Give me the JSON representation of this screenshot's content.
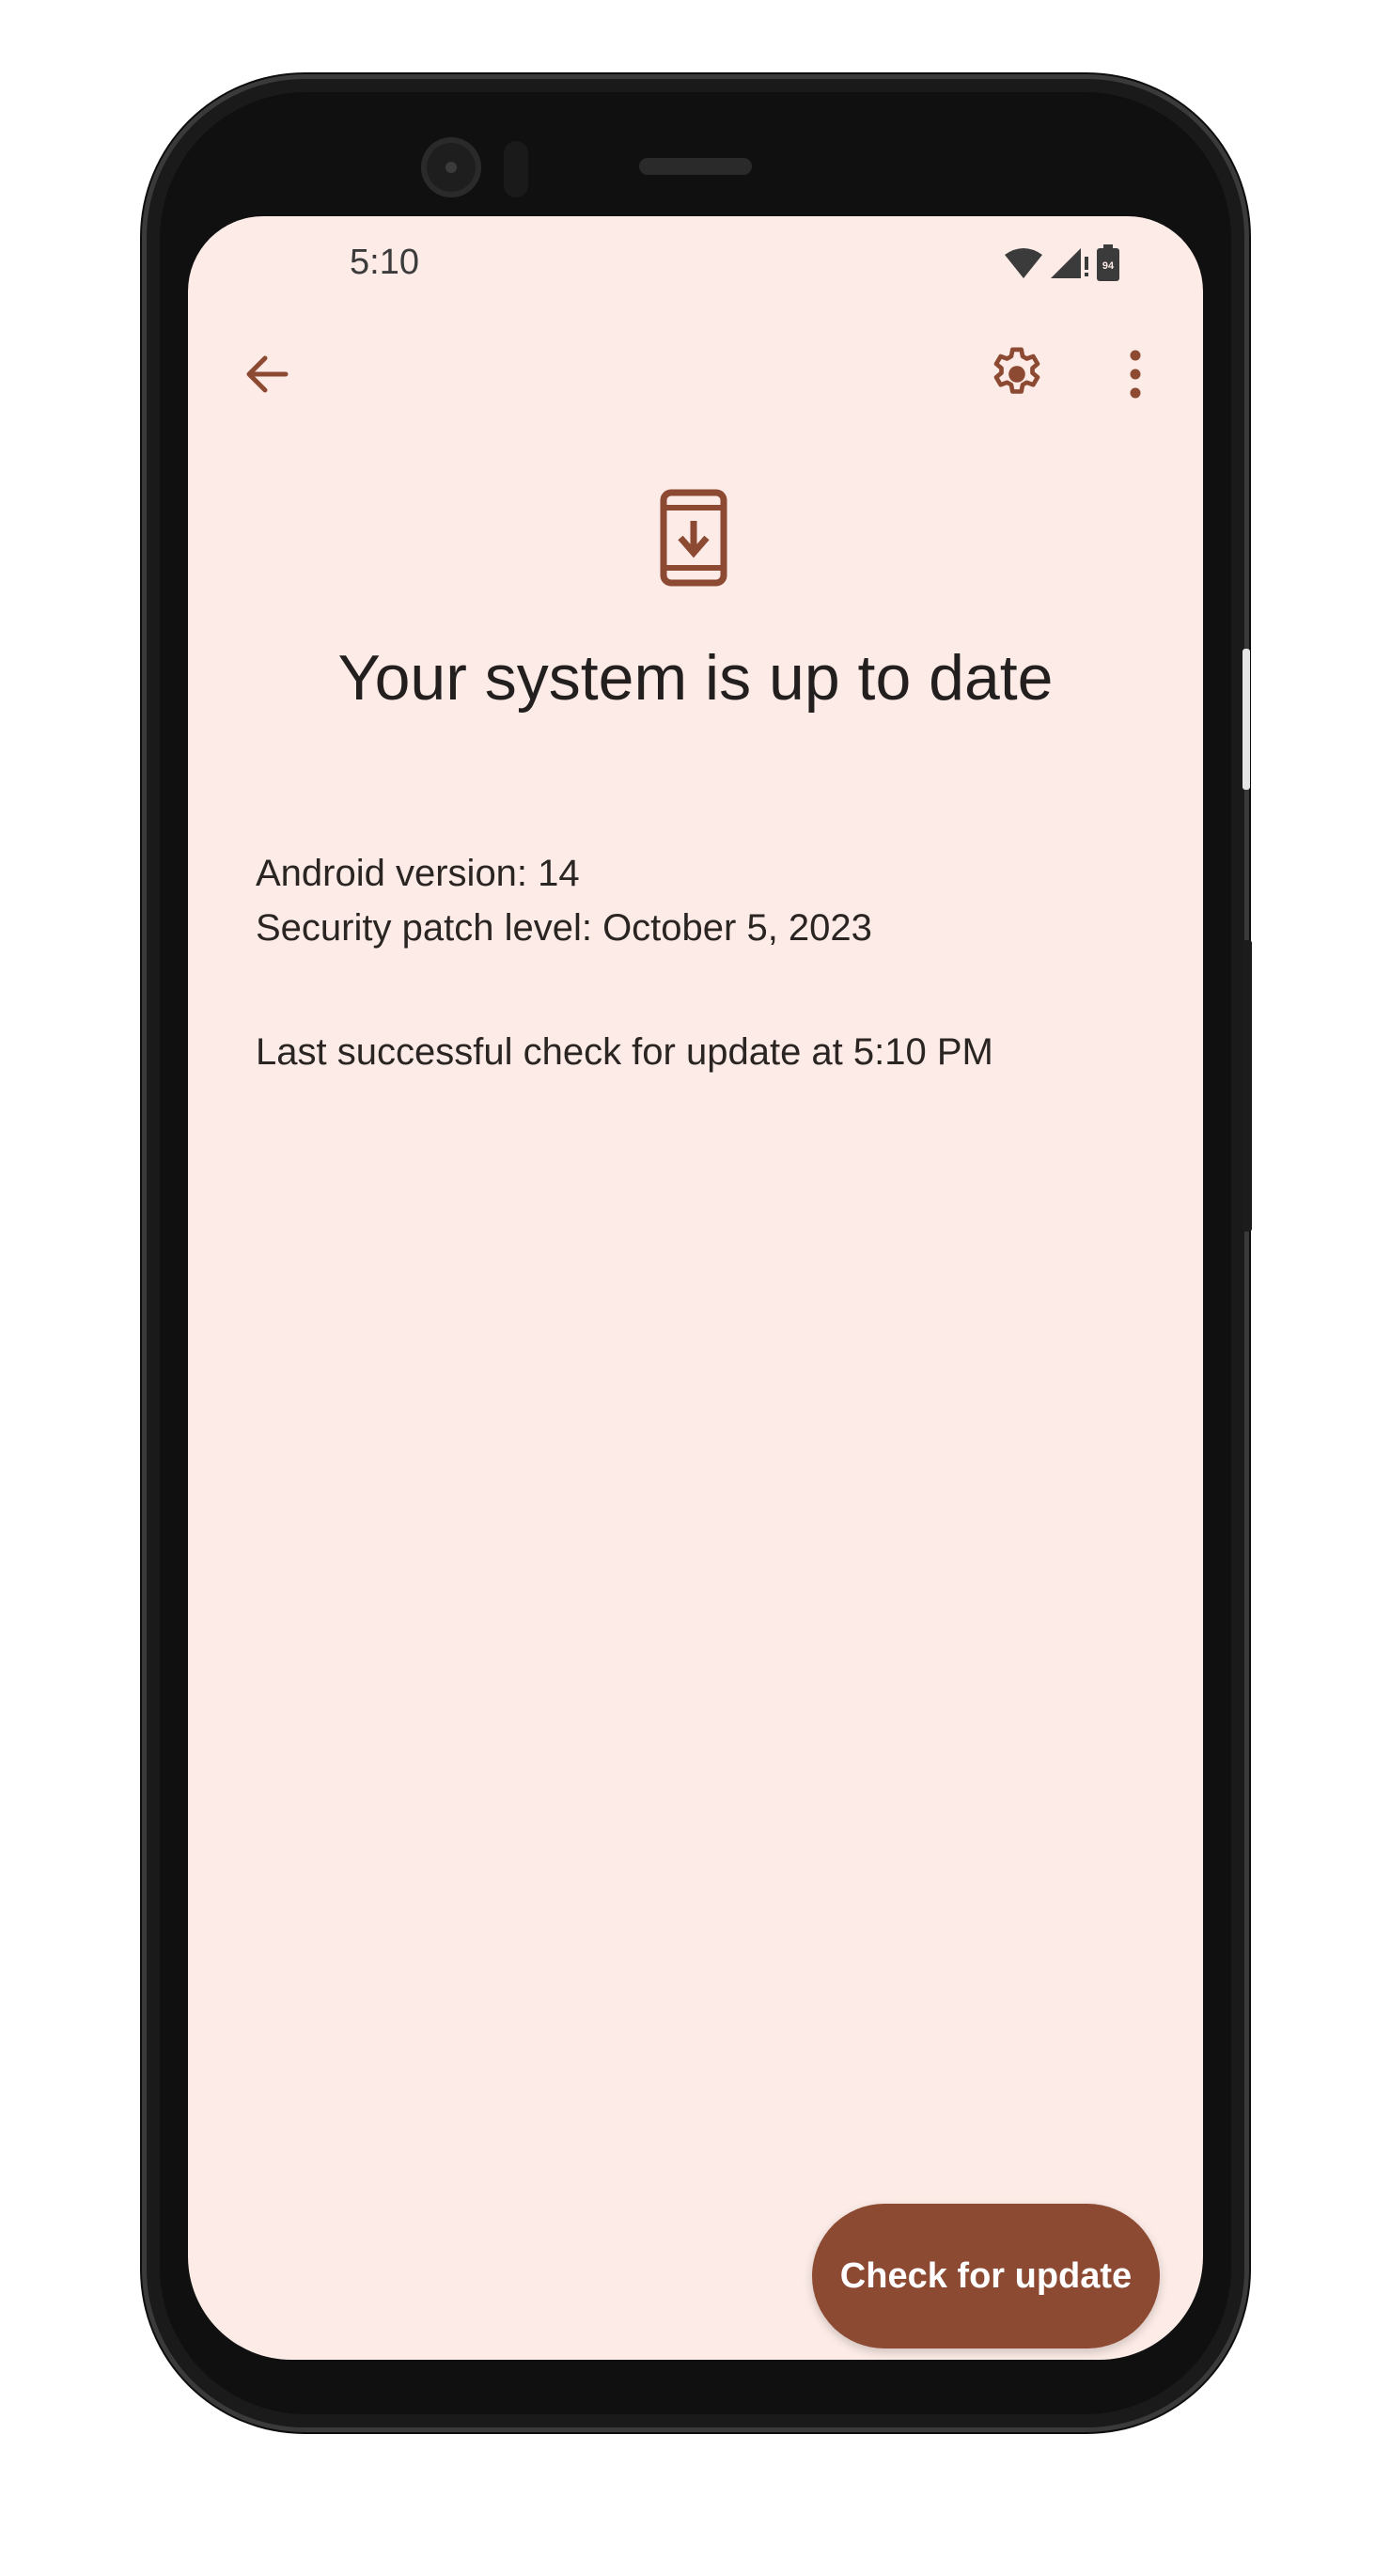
{
  "status_bar": {
    "time": "5:10",
    "battery_level": "94",
    "icons": [
      "wifi-icon",
      "cell-signal-icon",
      "battery-icon"
    ]
  },
  "app_bar": {
    "back_icon": "arrow-back-icon",
    "settings_icon": "gear-icon",
    "more_icon": "more-vert-icon"
  },
  "hero": {
    "icon": "system-update-icon"
  },
  "main": {
    "title": "Your system is up to date",
    "android_version": "Android version: 14",
    "security_patch": "Security patch level: October 5, 2023",
    "last_check": "Last successful check for update at 5:10 PM"
  },
  "actions": {
    "check_update_label": "Check for update"
  },
  "colors": {
    "accent": "#8d4a33",
    "background": "#fcebe6",
    "text": "#231f1e"
  }
}
